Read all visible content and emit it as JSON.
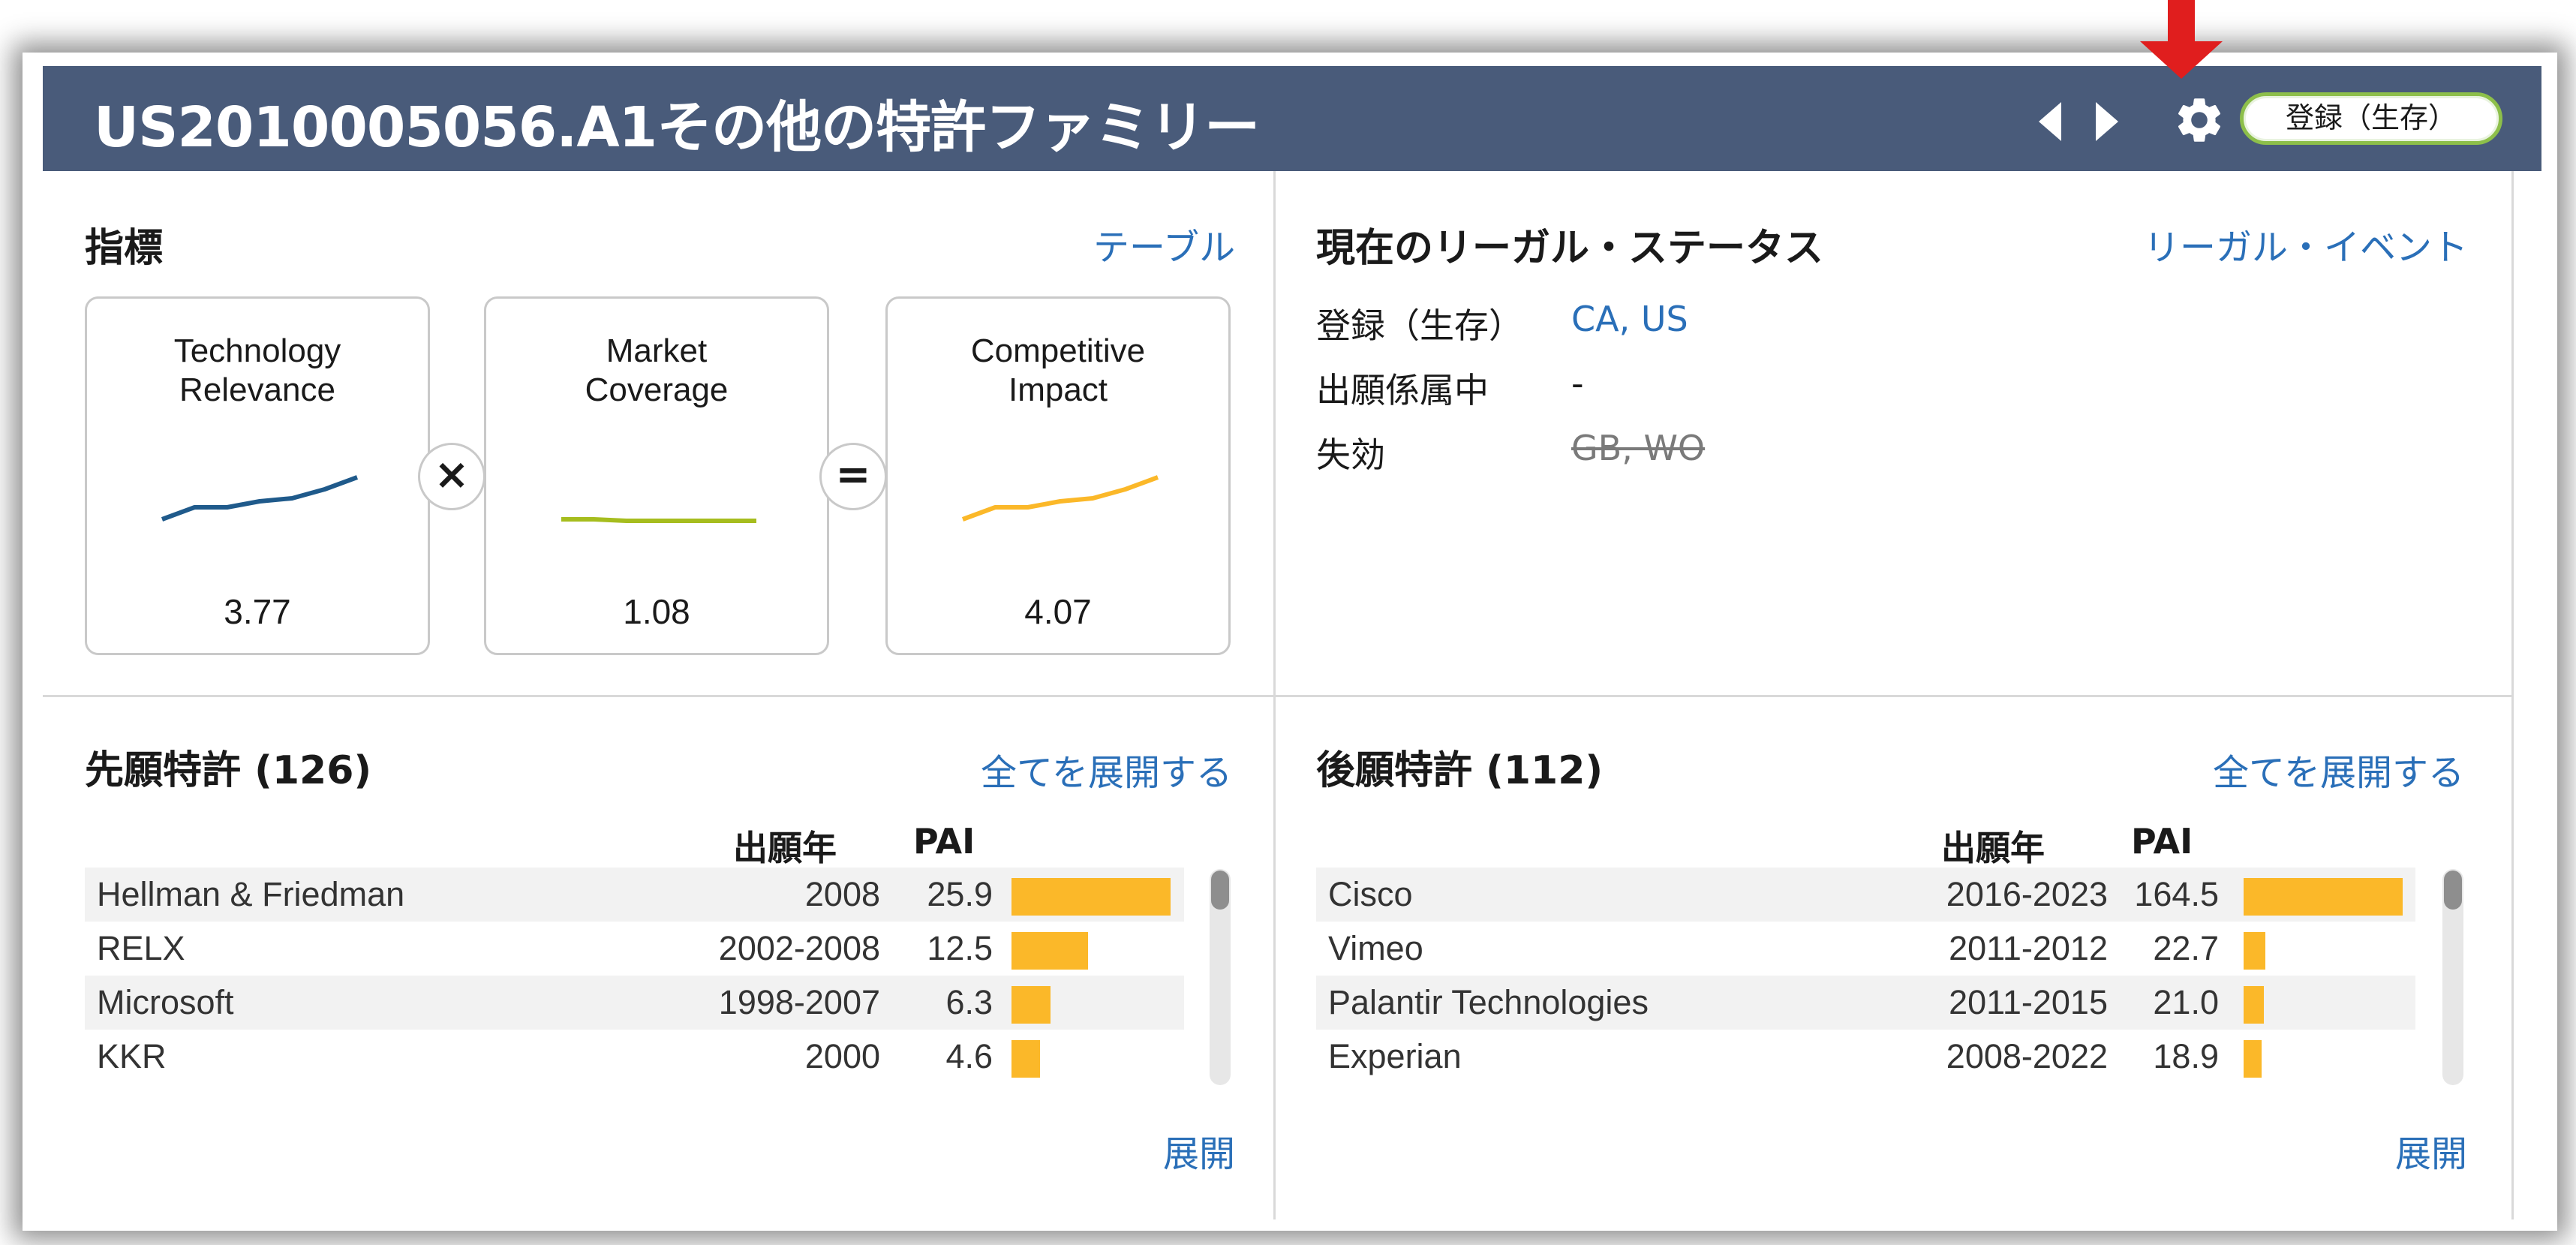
{
  "header": {
    "title": "US2010005056.A1その他の特許ファミリー",
    "status": "登録（生存）",
    "colors": {
      "bg": "#495b7a",
      "status_border": "#8dbf4a",
      "annotation_arrow": "#e01e1e"
    },
    "icons": {
      "prev": "chevron-left-icon",
      "next": "chevron-right-icon",
      "settings": "gear-icon"
    }
  },
  "metrics": {
    "title": "指標",
    "link": "テーブル",
    "items": [
      {
        "label_line1": "Technology",
        "label_line2": "Relevance",
        "value": "3.77",
        "color": "#1f5a8b",
        "trend": [
          1.0,
          1.4,
          1.4,
          1.6,
          1.7,
          2.0,
          2.4
        ]
      },
      {
        "label_line1": "Market",
        "label_line2": "Coverage",
        "value": "1.08",
        "color": "#a6bd1e",
        "trend": [
          1.0,
          1.0,
          0.95,
          0.95,
          0.95,
          0.95,
          0.95
        ]
      },
      {
        "label_line1": "Competitive",
        "label_line2": "Impact",
        "value": "4.07",
        "color": "#fbb829",
        "trend": [
          1.0,
          1.4,
          1.4,
          1.6,
          1.7,
          2.0,
          2.4
        ]
      }
    ],
    "operators": [
      "×",
      "="
    ]
  },
  "legal": {
    "title": "現在のリーガル・ステータス",
    "link": "リーガル・イベント",
    "rows": [
      {
        "key": "登録（生存）",
        "value": "CA, US"
      },
      {
        "key": "出願係属中",
        "value": "-"
      },
      {
        "key": "失効",
        "value": "GB, WO"
      }
    ]
  },
  "prior": {
    "title": "先願特許 (126)",
    "link": "全てを展開する",
    "col_year": "出願年",
    "col_pai": "PAI",
    "expand": "展開",
    "max_pai": 25.9,
    "rows": [
      {
        "name": "Hellman & Friedman",
        "year": "2008",
        "pai": "25.9",
        "pai_value": 25.9
      },
      {
        "name": "RELX",
        "year": "2002-2008",
        "pai": "12.5",
        "pai_value": 12.5
      },
      {
        "name": "Microsoft",
        "year": "1998-2007",
        "pai": "6.3",
        "pai_value": 6.3
      },
      {
        "name": "KKR",
        "year": "2000",
        "pai": "4.6",
        "pai_value": 4.6
      }
    ]
  },
  "later": {
    "title": "後願特許 (112)",
    "link": "全てを展開する",
    "col_year": "出願年",
    "col_pai": "PAI",
    "expand": "展開",
    "max_pai": 164.5,
    "rows": [
      {
        "name": "Cisco",
        "year": "2016-2023",
        "pai": "164.5",
        "pai_value": 164.5
      },
      {
        "name": "Vimeo",
        "year": "2011-2012",
        "pai": "22.7",
        "pai_value": 22.7
      },
      {
        "name": "Palantir Technologies",
        "year": "2011-2015",
        "pai": "21.0",
        "pai_value": 21.0
      },
      {
        "name": "Experian",
        "year": "2008-2022",
        "pai": "18.9",
        "pai_value": 18.9
      }
    ]
  }
}
